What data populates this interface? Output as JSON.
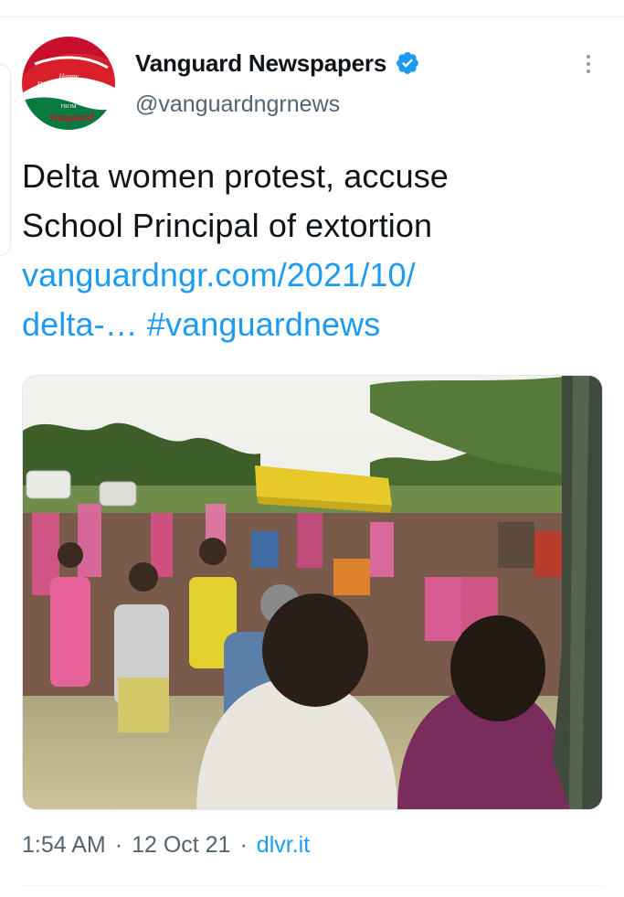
{
  "tweet": {
    "author": {
      "display_name": "Vanguard Newspapers",
      "handle": "@vanguardngrnews",
      "verified": true,
      "avatar_text": [
        "Happy",
        "INDEPENDENCE",
        "DAY",
        "FROM",
        "Vanguard"
      ]
    },
    "text_lines": [
      "Delta women protest, accuse",
      "School Principal of extortion"
    ],
    "link_line_1": "vanguardngr.com/2021/10/",
    "link_line_2_link": "delta-…",
    "hashtag": "#vanguardnews",
    "media": {
      "description": "photo of protesting crowd"
    },
    "time": "1:54 AM",
    "separator": "·",
    "date": "12 Oct 21",
    "source": "dlvr.it"
  },
  "colors": {
    "link": "#1d9bf0",
    "secondary_text": "#536471",
    "verified_badge": "#1d9bf0",
    "divider": "#eff3f4"
  },
  "icons": {
    "verified": "verified-badge-icon",
    "more": "more-options-icon"
  }
}
